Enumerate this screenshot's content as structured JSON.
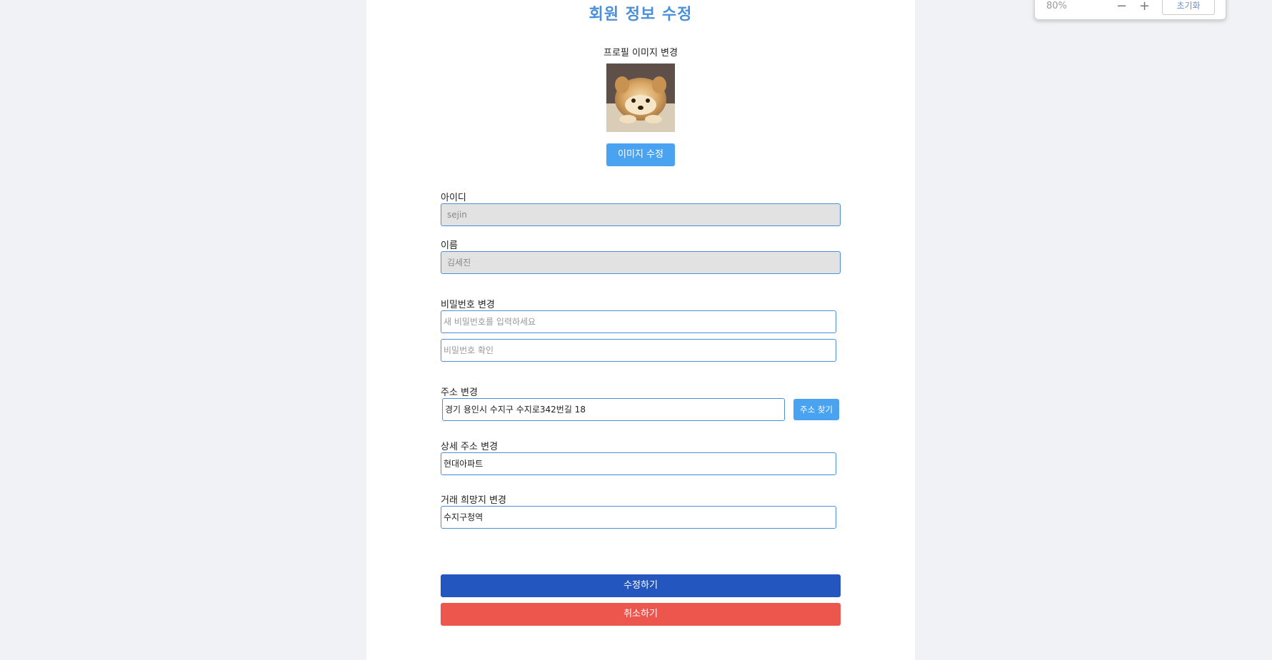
{
  "page": {
    "title": "회원 정보 수정",
    "profile_label": "프로필 이미지 변경",
    "image_button": "이미지 수정"
  },
  "fields": {
    "id": {
      "label": "아이디",
      "value": "sejin"
    },
    "name": {
      "label": "이름",
      "value": "김세진"
    },
    "password": {
      "label": "비밀번호 변경",
      "new_placeholder": "새 비밀번호를 입력하세요",
      "confirm_placeholder": "비밀번호 확인"
    },
    "address": {
      "label": "주소 변경",
      "value": "경기 용인시 수지구 수지로342번길 18",
      "search_button": "주소 찾기"
    },
    "detail_address": {
      "label": "상세 주소 변경",
      "value": "현대아파트"
    },
    "trade_place": {
      "label": "거래 희망지 변경",
      "value": "수지구청역"
    }
  },
  "actions": {
    "submit": "수정하기",
    "cancel": "취소하기"
  },
  "zoom_popup": {
    "level": "80%",
    "minus": "−",
    "plus": "+",
    "reset": "초기화"
  },
  "colors": {
    "accent": "#4aa3f0",
    "submit": "#2456c0",
    "cancel": "#ec564d",
    "title": "#4a90d9"
  }
}
